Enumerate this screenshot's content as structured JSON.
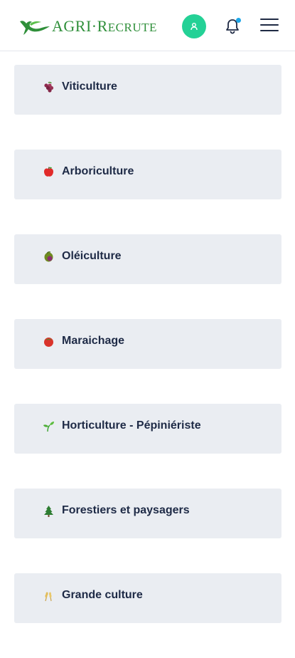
{
  "header": {
    "logo_text_main": "AGRI",
    "logo_text_sep": "·",
    "logo_text_r": "R",
    "logo_text_rest": "ECRUTE",
    "brand_color": "#2f8f3a",
    "accent_color": "#24d196",
    "avatar_icon": "user-icon",
    "notification_icon": "bell-icon",
    "menu_icon": "hamburger-icon"
  },
  "categories": [
    {
      "label": "Viticulture",
      "icon": "grapes-icon"
    },
    {
      "label": "Arboriculture",
      "icon": "apple-icon"
    },
    {
      "label": "Oléiculture",
      "icon": "olive-icon"
    },
    {
      "label": "Maraichage",
      "icon": "tomato-icon"
    },
    {
      "label": "Horticulture - Pépiniériste",
      "icon": "seedling-icon"
    },
    {
      "label": "Forestiers et paysagers",
      "icon": "tree-icon"
    },
    {
      "label": "Grande culture",
      "icon": "wheat-icon"
    }
  ]
}
